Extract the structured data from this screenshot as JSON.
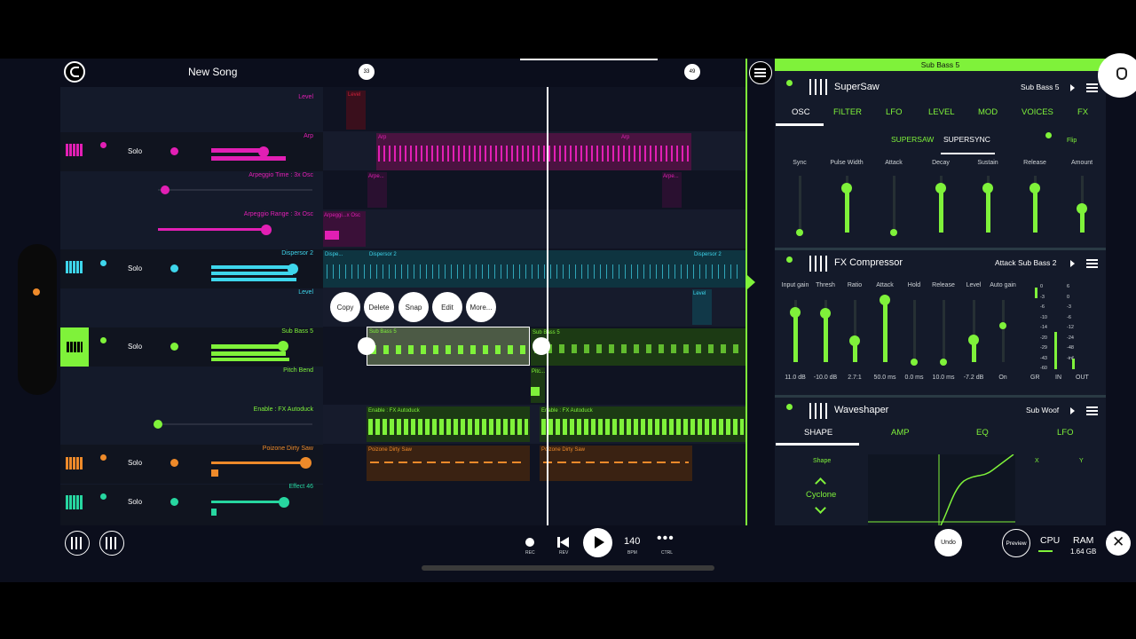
{
  "song": {
    "title": "New Song"
  },
  "timeline": {
    "marker_a": "33",
    "marker_b": "49"
  },
  "tracks": [
    {
      "name": "Arp",
      "solo": "Solo",
      "lanes": [
        "Arpeggio Time : 3x Osc",
        "Arpeggio Range : 3x Osc"
      ]
    },
    {
      "name": "Dispersor 2",
      "solo": "Solo",
      "lanes": [
        "Level"
      ]
    },
    {
      "name": "Sub Bass 5",
      "solo": "Solo",
      "lanes": [
        "Pitch Bend",
        "Enable : FX Autoduck"
      ]
    },
    {
      "name": "Poizone Dirty Saw",
      "solo": "Solo"
    },
    {
      "name": "Effect 46",
      "solo": "Solo"
    }
  ],
  "top_lane": "Level",
  "clips": {
    "level": "Level",
    "arp_a": "Arp",
    "arp_b": "Arp",
    "arpe_a": "Arpe...",
    "arpe_b": "Arpe...",
    "arpeggi": "Arpeggi...x Osc",
    "disp_a": "Dispe...",
    "disp_b": "Dispersor 2",
    "disp_c": "Dispersor 2",
    "level2": "Level",
    "sub_a": "Sub Bass 5",
    "sub_b": "Sub Bass 5",
    "pitch": "Pitc...",
    "duck_a": "Enable : FX Autoduck",
    "duck_b": "Enable : FX Autoduck",
    "saw_a": "Poizone Dirty Saw",
    "saw_b": "Poizone Dirty Saw"
  },
  "context_menu": [
    "Copy",
    "Delete",
    "Snap",
    "Edit",
    "More..."
  ],
  "transport": {
    "rec": "REC",
    "rev": "REV",
    "bpm_value": "140",
    "bpm_label": "BPM",
    "ctrl": "CTRL",
    "undo": "Undo",
    "preview": "Preview",
    "cpu": "CPU",
    "ram": "RAM",
    "ram_value": "1.64 GB"
  },
  "right": {
    "title": "Sub Bass 5",
    "supersaw": {
      "name": "SuperSaw",
      "preset": "Sub Bass 5",
      "tabs": [
        "OSC",
        "FILTER",
        "LFO",
        "LEVEL",
        "MOD",
        "VOICES",
        "FX"
      ],
      "subtabs": [
        "SUPERSAW",
        "SUPERSYNC"
      ],
      "flip": "Flip",
      "params": [
        {
          "label": "Sync",
          "value": 0.0
        },
        {
          "label": "Pulse Width",
          "value": 0.78
        },
        {
          "label": "Attack",
          "value": 0.0
        },
        {
          "label": "Decay",
          "value": 0.78
        },
        {
          "label": "Sustain",
          "value": 0.78
        },
        {
          "label": "Release",
          "value": 0.78
        },
        {
          "label": "Amount",
          "value": 0.42
        }
      ]
    },
    "compressor": {
      "name": "FX Compressor",
      "preset": "Attack Sub Bass 2",
      "params": [
        {
          "label": "Input gain",
          "value": "11.0 dB",
          "level": 0.8
        },
        {
          "label": "Thresh",
          "value": "-10.0 dB",
          "level": 0.78
        },
        {
          "label": "Ratio",
          "value": "2.7:1",
          "level": 0.35
        },
        {
          "label": "Attack",
          "value": "50.0 ms",
          "level": 1.0
        },
        {
          "label": "Hold",
          "value": "0.0 ms",
          "level": 0.0
        },
        {
          "label": "Release",
          "value": "10.0 ms",
          "level": 0.0
        },
        {
          "label": "Level",
          "value": "-7.2 dB",
          "level": 0.36
        },
        {
          "label": "Auto gain",
          "value": "On",
          "level": 0.58
        }
      ],
      "meter_left": [
        "0",
        "-3",
        "-6",
        "-10",
        "-14",
        "-20",
        "-29",
        "-43",
        "-60"
      ],
      "meter_right": [
        "6",
        "0",
        "-3",
        "-6",
        "-12",
        "-24",
        "-48",
        "-inf"
      ],
      "meter_labels": [
        "GR",
        "IN",
        "OUT"
      ]
    },
    "waveshaper": {
      "name": "Waveshaper",
      "preset": "Sub Woof",
      "tabs": [
        "SHAPE",
        "AMP",
        "EQ",
        "LFO"
      ],
      "shape_label": "Shape",
      "shape_value": "Cyclone",
      "x": "X",
      "y": "Y"
    }
  },
  "colors": {
    "green": "#7ff23a",
    "pink": "#e21fb4",
    "cyan": "#3ed6ec",
    "orange": "#ee8a2a",
    "teal": "#27d6a0",
    "red": "#d0203a"
  }
}
